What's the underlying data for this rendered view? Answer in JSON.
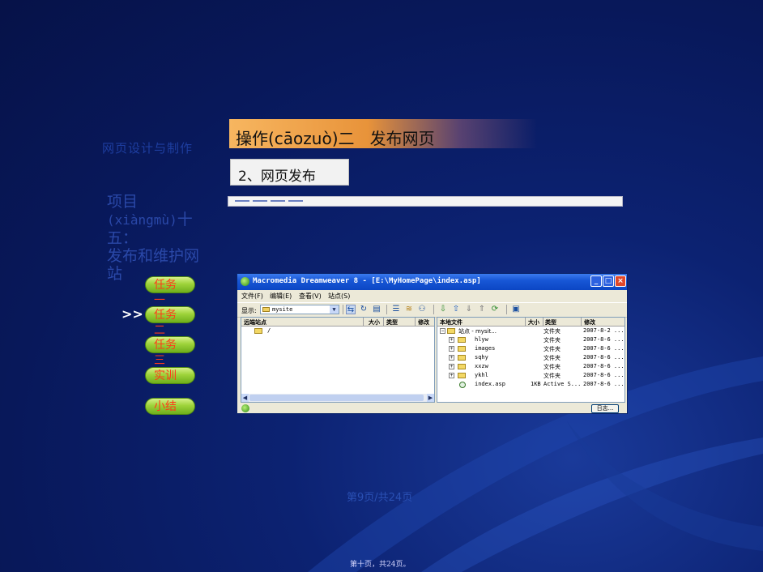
{
  "course": {
    "title": "网页设计与制作"
  },
  "project": {
    "prefix": "项目",
    "pinyin": "(xiàngmù)",
    "number": "十五：",
    "name": "发布和维护网站"
  },
  "nav": {
    "current_marker": ">>",
    "items": [
      {
        "label": "任务一"
      },
      {
        "label": "任务二"
      },
      {
        "label": "任务三"
      },
      {
        "label": "实训"
      },
      {
        "label": "小结"
      }
    ]
  },
  "content": {
    "operation_title": "操作(cāozuò)二   发布网页",
    "step_title": "2、网页发布"
  },
  "dw": {
    "title": "Macromedia Dreamweaver 8 - [E:\\MyHomePage\\index.asp]",
    "menu": [
      "文件(F)",
      "编辑(E)",
      "查看(V)",
      "站点(S)"
    ],
    "toolbar": {
      "show_label": "显示:",
      "site_value": "mysite"
    },
    "remote": {
      "headers": [
        "远端站点",
        "大小",
        "类型",
        "修改"
      ],
      "rows": [
        {
          "name": "/"
        }
      ]
    },
    "local": {
      "headers": [
        "本地文件",
        "大小",
        "类型",
        "修改"
      ],
      "root": {
        "name": "站点 - mysit...",
        "type": "文件夹",
        "modified": "2007-8-2 ..."
      },
      "rows": [
        {
          "name": "hlyw",
          "size": "",
          "type": "文件夹",
          "modified": "2007-8-6 ..."
        },
        {
          "name": "images",
          "size": "",
          "type": "文件夹",
          "modified": "2007-8-6 ..."
        },
        {
          "name": "sqhy",
          "size": "",
          "type": "文件夹",
          "modified": "2007-8-6 ..."
        },
        {
          "name": "xxzw",
          "size": "",
          "type": "文件夹",
          "modified": "2007-8-6 ..."
        },
        {
          "name": "ykhl",
          "size": "",
          "type": "文件夹",
          "modified": "2007-8-6 ..."
        },
        {
          "name": "index.asp",
          "size": "1KB",
          "type": "Active S...",
          "modified": "2007-8-6 ..."
        }
      ]
    },
    "log_button": "日志..."
  },
  "page": {
    "count": "第9页/共24页"
  },
  "footer": {
    "text": "第十页，共24页。"
  },
  "colors": {
    "background": "#0c2272",
    "nav_button": "#9ed33a",
    "nav_text": "#ff3a1a",
    "header": "#e8933a"
  }
}
